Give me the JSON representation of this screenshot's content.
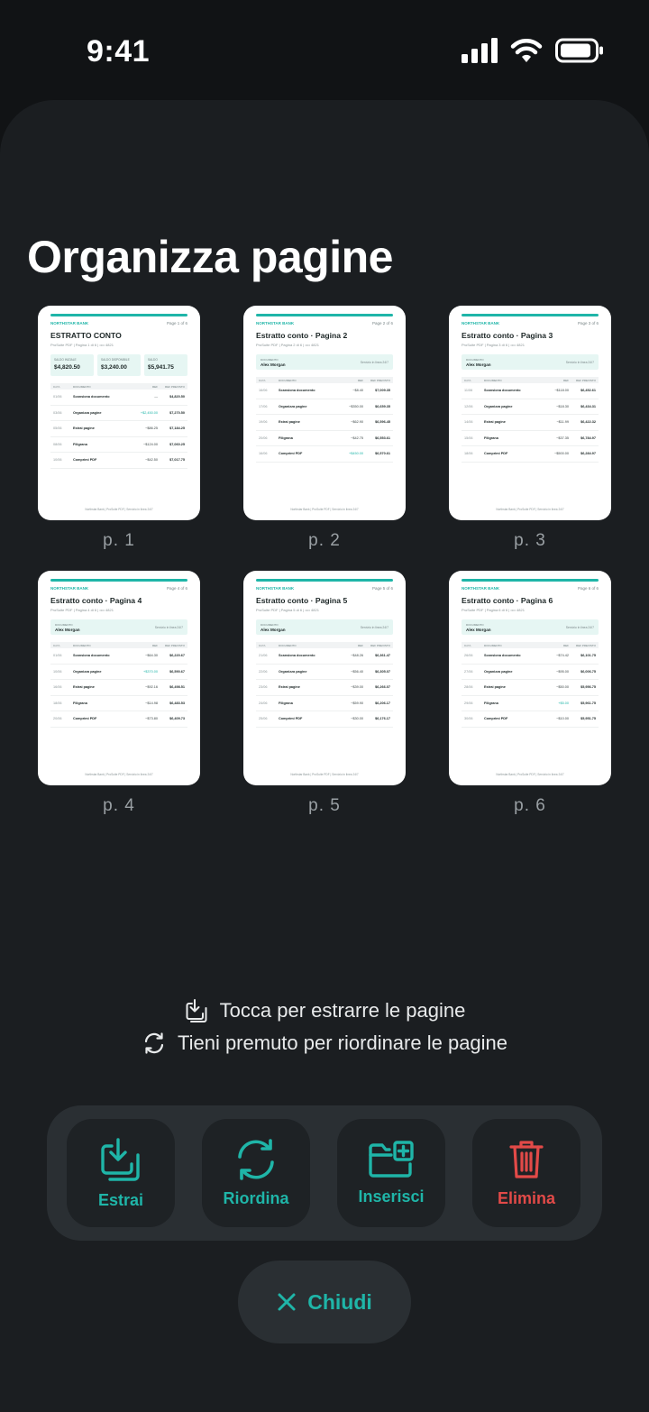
{
  "status": {
    "time": "9:41"
  },
  "title": "Organizza pagine",
  "pages": [
    {
      "label": "p. 1",
      "bank": "NORTHSTAR BANK",
      "page_no": "Page 1 of 6",
      "heading": "ESTRATTO CONTO",
      "sub": "ProSuite PDF  |  Pagina 1 di 6  |  •••• 4821",
      "cards": [
        {
          "k": "SALDO INIZIALE",
          "v": "$4,820.50"
        },
        {
          "k": "SALDO DISPONIBILE",
          "v": "$3,240.00"
        },
        {
          "k": "SALDO",
          "v": "$5,941.75"
        }
      ],
      "holder": null,
      "headers": [
        "DATA",
        "DOCUMENTO",
        "REF",
        "REF PREVISTO"
      ],
      "rows": [
        {
          "d": "01/06",
          "t": "Scansiona documento",
          "a": "—",
          "b": "$4,820.50",
          "pos": false
        },
        {
          "d": "03/06",
          "t": "Organizza pagine",
          "a": "+$2,450.00",
          "b": "$7,270.50",
          "pos": true
        },
        {
          "d": "05/06",
          "t": "Estrai pagine",
          "a": "−$86.25",
          "b": "$7,184.25",
          "pos": false
        },
        {
          "d": "08/06",
          "t": "Filigrana",
          "a": "−$124.00",
          "b": "$7,060.25",
          "pos": false
        },
        {
          "d": "10/06",
          "t": "Comprimi PDF",
          "a": "−$42.50",
          "b": "$7,017.75",
          "pos": false
        }
      ],
      "footer": "Northstar Bank  |  ProSuite PDF  |  Servizio in linea 24/7"
    },
    {
      "label": "p. 2",
      "bank": "NORTHSTAR BANK",
      "page_no": "Page 2 of 6",
      "heading": "Estratto conto · Pagina 2",
      "sub": "ProSuite PDF  |  Pagina 2 di 6  |  •••• 4821",
      "cards": null,
      "holder": {
        "k": "DOCUMENTO",
        "n": "Alex Morgan",
        "r": "Servizio in linea 24/7"
      },
      "headers": [
        "DATA",
        "DOCUMENTO",
        "REF",
        "REF PREVISTO"
      ],
      "rows": [
        {
          "d": "16/06",
          "t": "Scansiona documento",
          "a": "−$8.40",
          "b": "$7,009.35",
          "pos": false
        },
        {
          "d": "17/06",
          "t": "Organizza pagine",
          "a": "−$350.00",
          "b": "$6,659.35",
          "pos": false
        },
        {
          "d": "19/06",
          "t": "Estrai pagine",
          "a": "−$62.90",
          "b": "$6,596.45",
          "pos": false
        },
        {
          "d": "20/06",
          "t": "Filigrana",
          "a": "−$42.75",
          "b": "$6,553.61",
          "pos": false
        },
        {
          "d": "16/06",
          "t": "Comprimi PDF",
          "a": "+$450.00",
          "b": "$6,570.61",
          "pos": true
        }
      ],
      "footer": "Northstar Bank  |  ProSuite PDF  |  Servizio in linea 24/7"
    },
    {
      "label": "p. 3",
      "bank": "NORTHSTAR BANK",
      "page_no": "Page 3 of 6",
      "heading": "Estratto conto · Pagina 3",
      "sub": "ProSuite PDF  |  Pagina 3 di 6  |  •••• 4821",
      "cards": null,
      "holder": {
        "k": "DOCUMENTO",
        "n": "Alex Morgan",
        "r": "Servizio in linea 24/7"
      },
      "headers": [
        "DATA",
        "DOCUMENTO",
        "REF",
        "REF PREVISTO"
      ],
      "rows": [
        {
          "d": "11/06",
          "t": "Scansiona documento",
          "a": "−$118.00",
          "b": "$6,452.61",
          "pos": false
        },
        {
          "d": "12/06",
          "t": "Organizza pagine",
          "a": "−$18.30",
          "b": "$6,434.31",
          "pos": false
        },
        {
          "d": "14/06",
          "t": "Estrai pagine",
          "a": "−$11.99",
          "b": "$6,422.32",
          "pos": false
        },
        {
          "d": "15/06",
          "t": "Filigrana",
          "a": "−$37.35",
          "b": "$6,784.97",
          "pos": false
        },
        {
          "d": "18/06",
          "t": "Comprimi PDF",
          "a": "−$500.00",
          "b": "$6,284.97",
          "pos": false
        }
      ],
      "footer": "Northstar Bank  |  ProSuite PDF  |  Servizio in linea 24/7"
    },
    {
      "label": "p. 4",
      "bank": "NORTHSTAR BANK",
      "page_no": "Page 4 of 6",
      "heading": "Estratto conto · Pagina 4",
      "sub": "ProSuite PDF  |  Pagina 4 di 6  |  •••• 4821",
      "cards": null,
      "holder": {
        "k": "DOCUMENTO",
        "n": "Alex Morgan",
        "r": "Servizio in linea 24/7"
      },
      "headers": [
        "DATA",
        "DOCUMENTO",
        "REF",
        "REF PREVISTO"
      ],
      "rows": [
        {
          "d": "01/06",
          "t": "Scansiona documento",
          "a": "−$64.30",
          "b": "$6,220.67",
          "pos": false
        },
        {
          "d": "10/06",
          "t": "Organizza pagine",
          "a": "+$370.00",
          "b": "$6,590.67",
          "pos": true
        },
        {
          "d": "16/06",
          "t": "Estrai pagine",
          "a": "−$92.16",
          "b": "$6,498.51",
          "pos": false
        },
        {
          "d": "18/06",
          "t": "Filigrana",
          "a": "−$14.98",
          "b": "$6,483.53",
          "pos": false
        },
        {
          "d": "20/06",
          "t": "Comprimi PDF",
          "a": "−$73.80",
          "b": "$6,409.73",
          "pos": false
        }
      ],
      "footer": "Northstar Bank  |  ProSuite PDF  |  Servizio in linea 24/7"
    },
    {
      "label": "p. 5",
      "bank": "NORTHSTAR BANK",
      "page_no": "Page 5 of 6",
      "heading": "Estratto conto · Pagina 5",
      "sub": "ProSuite PDF  |  Pagina 5 di 6  |  •••• 4821",
      "cards": null,
      "holder": {
        "k": "DOCUMENTO",
        "n": "Alex Morgan",
        "r": "Servizio in linea 24/7"
      },
      "headers": [
        "DATA",
        "DOCUMENTO",
        "REF",
        "REF PREVISTO"
      ],
      "rows": [
        {
          "d": "21/06",
          "t": "Scansiona documento",
          "a": "−$48.26",
          "b": "$6,361.47",
          "pos": false
        },
        {
          "d": "22/06",
          "t": "Organizza pagine",
          "a": "−$56.40",
          "b": "$6,305.07",
          "pos": false
        },
        {
          "d": "23/06",
          "t": "Estrai pagine",
          "a": "−$39.00",
          "b": "$6,266.07",
          "pos": false
        },
        {
          "d": "24/06",
          "t": "Filigrana",
          "a": "−$59.90",
          "b": "$6,206.17",
          "pos": false
        },
        {
          "d": "25/06",
          "t": "Comprimi PDF",
          "a": "−$30.00",
          "b": "$6,176.17",
          "pos": false
        }
      ],
      "footer": "Northstar Bank  |  ProSuite PDF  |  Servizio in linea 24/7"
    },
    {
      "label": "p. 6",
      "bank": "NORTHSTAR BANK",
      "page_no": "Page 6 of 6",
      "heading": "Estratto conto · Pagina 6",
      "sub": "ProSuite PDF  |  Pagina 6 di 6  |  •••• 4821",
      "cards": null,
      "holder": {
        "k": "DOCUMENTO",
        "n": "Alex Morgan",
        "r": "Servizio in linea 24/7"
      },
      "headers": [
        "DATA",
        "DOCUMENTO",
        "REF",
        "REF PREVISTO"
      ],
      "rows": [
        {
          "d": "26/06",
          "t": "Scansiona documento",
          "a": "−$74.42",
          "b": "$6,101.75",
          "pos": false
        },
        {
          "d": "27/06",
          "t": "Organizza pagine",
          "a": "−$95.00",
          "b": "$6,006.75",
          "pos": false
        },
        {
          "d": "28/06",
          "t": "Estrai pagine",
          "a": "−$50.00",
          "b": "$5,956.75",
          "pos": false
        },
        {
          "d": "29/06",
          "t": "Filigrana",
          "a": "+$5.00",
          "b": "$5,961.75",
          "pos": true
        },
        {
          "d": "30/06",
          "t": "Comprimi PDF",
          "a": "−$10.00",
          "b": "$5,951.75",
          "pos": false
        }
      ],
      "footer": "Northstar Bank  |  ProSuite PDF  |  Servizio in linea 24/7"
    }
  ],
  "hints": {
    "extract": {
      "icon": "extract-icon",
      "text": "Tocca per estrarre le pagine"
    },
    "reorder": {
      "icon": "reorder-icon",
      "text": "Tieni premuto per riordinare le pagine"
    }
  },
  "actions": {
    "extract": {
      "label": "Estrai",
      "icon": "extract-icon"
    },
    "reorder": {
      "label": "Riordina",
      "icon": "reorder-icon"
    },
    "insert": {
      "label": "Inserisci",
      "icon": "folder-add-icon"
    },
    "delete": {
      "label": "Elimina",
      "icon": "trash-icon"
    }
  },
  "close": {
    "label": "Chiudi",
    "icon": "close-icon"
  },
  "colors": {
    "accent": "#1fb5a8",
    "danger": "#e24a48",
    "background": "#111315",
    "sheet": "#1b1e21"
  }
}
